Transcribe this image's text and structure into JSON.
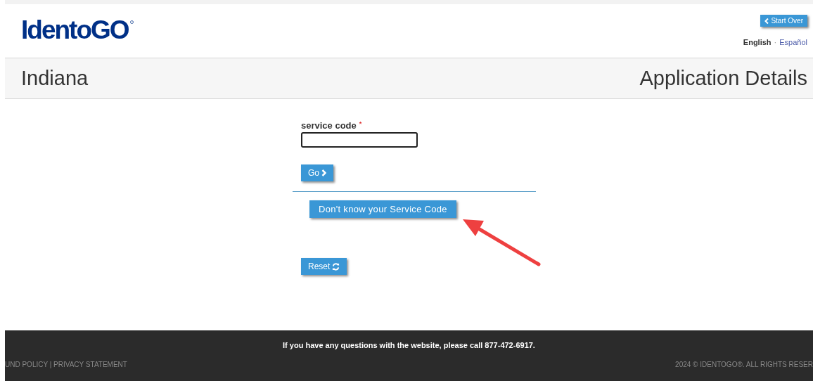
{
  "header": {
    "logo": "IdentoGO",
    "start_over": "Start Over",
    "separator": "·",
    "languages": [
      {
        "label": "English",
        "selected": true
      },
      {
        "label": "Español",
        "selected": false
      }
    ]
  },
  "title_bar": {
    "state": "Indiana",
    "page": "Application Details"
  },
  "form": {
    "label": "service code",
    "required_mark": "*",
    "go": "Go",
    "help_button": "Don't know your Service Code",
    "reset": "Reset"
  },
  "footer": {
    "message": "If you have any questions with the website, please call 877-472-6917.",
    "links": "UND POLICY | PRIVACY STATEMENT",
    "copyright": "2024 © IDENTOGO®. ALL RIGHTS RESER"
  }
}
